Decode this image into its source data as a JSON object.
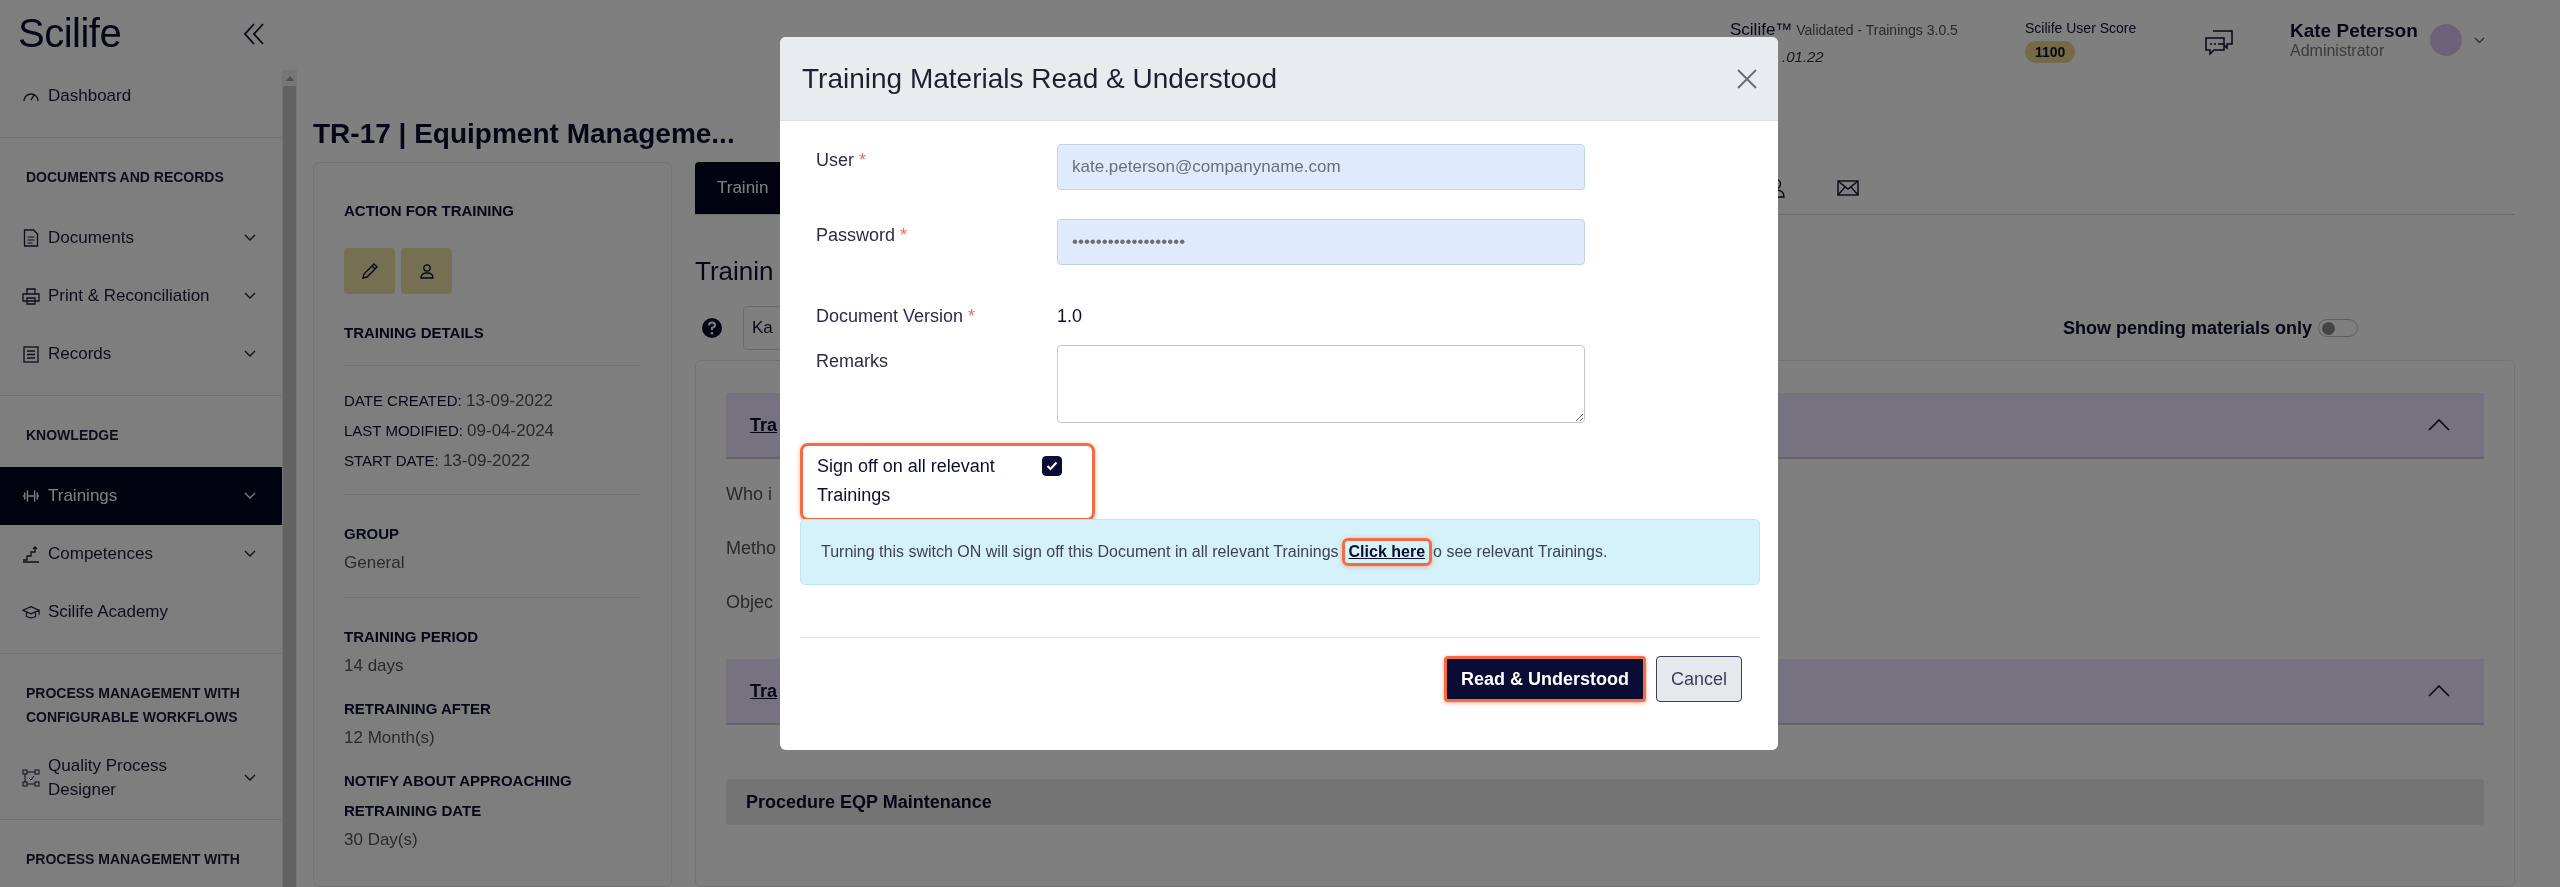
{
  "sidebar": {
    "logo": "Scilife",
    "groups": [
      {
        "items": [
          {
            "label": "Dashboard",
            "selected": false,
            "expandable": false
          }
        ]
      },
      {
        "heading": "DOCUMENTS AND RECORDS",
        "items": [
          {
            "label": "Documents",
            "selected": false,
            "expandable": true
          },
          {
            "label": "Print & Reconciliation",
            "selected": false,
            "expandable": true
          },
          {
            "label": "Records",
            "selected": false,
            "expandable": true
          }
        ]
      },
      {
        "heading": "KNOWLEDGE",
        "items": [
          {
            "label": "Trainings",
            "selected": true,
            "expandable": true
          },
          {
            "label": "Competences",
            "selected": false,
            "expandable": true
          },
          {
            "label": "Scilife Academy",
            "selected": false,
            "expandable": false
          }
        ]
      },
      {
        "heading": "PROCESS MANAGEMENT WITH CONFIGURABLE WORKFLOWS",
        "items": [
          {
            "label": "Quality Process Designer",
            "selected": false,
            "expandable": true
          }
        ]
      },
      {
        "heading": "PROCESS MANAGEMENT WITH"
      }
    ]
  },
  "header": {
    "product": "Scilife™",
    "version": "Validated - Trainings 3.0.5",
    "build": ".01.22",
    "score_label": "Scilife User Score",
    "score": "1100",
    "user_name": "Kate Peterson",
    "user_role": "Administrator"
  },
  "page": {
    "title": "TR-17 | Equipment Manageme...",
    "details": {
      "action_heading": "ACTION FOR TRAINING",
      "details_heading": "TRAINING DETAILS",
      "dates": [
        {
          "label": "DATE CREATED:",
          "value": "13-09-2022"
        },
        {
          "label": "LAST MODIFIED:",
          "value": "09-04-2024"
        },
        {
          "label": "START DATE:",
          "value": "13-09-2022"
        }
      ],
      "group": {
        "label": "GROUP",
        "value": "General"
      },
      "fields": [
        {
          "label": "TRAINING PERIOD",
          "value": "14 days"
        },
        {
          "label": "RETRAINING AFTER",
          "value": "12 Month(s)"
        },
        {
          "label": "NOTIFY ABOUT APPROACHING RETRAINING DATE",
          "value": "30 Day(s)"
        }
      ]
    },
    "tabs": [
      {
        "label": "Trainin",
        "selected": true
      }
    ],
    "section_title": "Trainin",
    "filter": {
      "value": "Ka"
    },
    "pending_toggle": {
      "label": "Show pending materials only",
      "on": false
    },
    "sections": [
      {
        "title": "Tra",
        "expanded": true,
        "rows": [
          "Who i",
          "Metho",
          "Objec"
        ]
      },
      {
        "title": "Tra",
        "expanded": true,
        "materials": [
          "Procedure EQP Maintenance"
        ]
      }
    ]
  },
  "modal": {
    "title": "Training Materials Read & Understood",
    "fields": [
      {
        "kind": "input",
        "label": "User",
        "required_mark": "*",
        "value": "kate.peterson@companyname.com"
      },
      {
        "kind": "input",
        "label": "Password",
        "required_mark": "*",
        "value": "•••••••••••••••••••"
      },
      {
        "kind": "text",
        "label": "Document Version",
        "required_mark": "*",
        "value": "1.0"
      },
      {
        "kind": "textarea",
        "label": "Remarks"
      }
    ],
    "sign_off": {
      "label": "Sign off on all relevant Trainings",
      "checked": true,
      "highlighted": true
    },
    "info": {
      "text_before": "Turning this switch ON will sign off this Document in all relevant Trainings",
      "link": "Click here",
      "link_highlighted": true,
      "text_after": "o see relevant Trainings."
    },
    "buttons": [
      {
        "kind": "primary",
        "label": "Read & Understood",
        "highlighted": true
      },
      {
        "kind": "secondary",
        "label": "Cancel",
        "highlighted": false
      }
    ]
  }
}
